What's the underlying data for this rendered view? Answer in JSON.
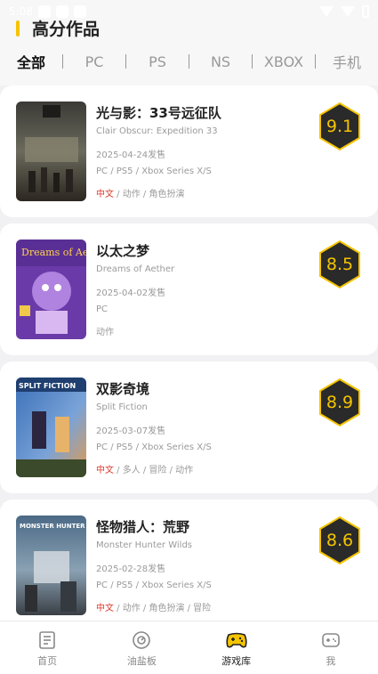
{
  "status_bar": {
    "time": "5:08"
  },
  "header": {
    "title": "高分作品"
  },
  "tabs": [
    {
      "label": "全部",
      "active": true
    },
    {
      "label": "PC",
      "active": false
    },
    {
      "label": "PS",
      "active": false
    },
    {
      "label": "NS",
      "active": false
    },
    {
      "label": "XBOX",
      "active": false
    },
    {
      "label": "手机",
      "active": false
    }
  ],
  "games": [
    {
      "title": "光与影：33号远征队",
      "english_title": "Clair Obscur: Expedition 33",
      "release": "2025-04-24发售",
      "platforms": "PC / PS5 / Xbox Series X/S",
      "tag_lang": "中文",
      "tags_rest": " / 动作 / 角色扮演",
      "score": "9.1"
    },
    {
      "title": "以太之梦",
      "english_title": "Dreams of Aether",
      "release": "2025-04-02发售",
      "platforms": "PC",
      "tag_lang": "",
      "tags_rest": "动作",
      "score": "8.5",
      "cover_text": "Dreams of Aether"
    },
    {
      "title": "双影奇境",
      "english_title": "Split Fiction",
      "release": "2025-03-07发售",
      "platforms": "PC / PS5 / Xbox Series X/S",
      "tag_lang": "中文",
      "tags_rest": " / 多人 / 冒险 / 动作",
      "score": "8.9",
      "cover_text": "SPLIT FICTION"
    },
    {
      "title": "怪物猎人：荒野",
      "english_title": "Monster Hunter Wilds",
      "release": "2025-02-28发售",
      "platforms": "PC / PS5 / Xbox Series X/S",
      "tag_lang": "中文",
      "tags_rest": " / 动作 / 角色扮演 / 冒险",
      "score": "8.6",
      "cover_text": "MONSTER HUNTER"
    }
  ],
  "bottom_nav": [
    {
      "label": "首页",
      "icon": "document-icon",
      "active": false
    },
    {
      "label": "油盐板",
      "icon": "dial-icon",
      "active": false
    },
    {
      "label": "游戏库",
      "icon": "gamepad-icon",
      "active": true
    },
    {
      "label": "我",
      "icon": "controller-profile-icon",
      "active": false
    }
  ],
  "colors": {
    "accent": "#f5c400",
    "tag_red": "#e0392b",
    "score_bg": "#2a2a2a"
  }
}
